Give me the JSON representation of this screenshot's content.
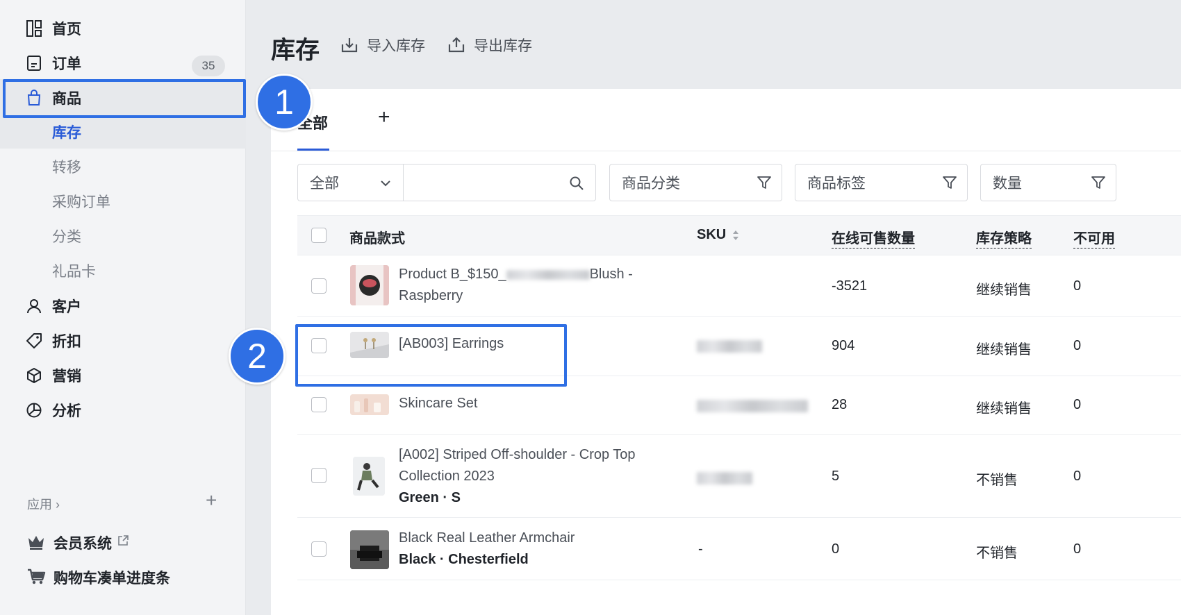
{
  "sidebar": {
    "items": [
      {
        "label": "首页",
        "icon": "home-grid-icon"
      },
      {
        "label": "订单",
        "icon": "order-doc-icon",
        "badge": "35"
      },
      {
        "label": "商品",
        "icon": "shopping-bag-icon"
      },
      {
        "label": "客户",
        "icon": "person-icon"
      },
      {
        "label": "折扣",
        "icon": "tag-icon"
      },
      {
        "label": "营销",
        "icon": "cube-icon"
      },
      {
        "label": "分析",
        "icon": "pie-chart-icon"
      }
    ],
    "sub_items": [
      "库存",
      "转移",
      "采购订单",
      "分类",
      "礼品卡"
    ],
    "apps_label": "应用 ›",
    "apps_add": "+",
    "apps": [
      {
        "label": "会员系统",
        "icon": "crown-icon"
      },
      {
        "label": "购物车凑单进度条",
        "icon": "cart-icon"
      }
    ]
  },
  "markers": [
    "1",
    "2"
  ],
  "header": {
    "title": "库存",
    "import_label": "导入库存",
    "export_label": "导出库存"
  },
  "tabs": {
    "active": "全部",
    "add": "+"
  },
  "filters": {
    "scope_select": "全部",
    "search_placeholder": "",
    "category": "商品分类",
    "tags": "商品标签",
    "quantity": "数量"
  },
  "table": {
    "columns": [
      "商品款式",
      "SKU",
      "在线可售数量",
      "库存策略",
      "不可用"
    ],
    "rows": [
      {
        "name": "Product B_$150_",
        "name_tail": "Blush -",
        "name2": "Raspberry",
        "variant": "",
        "sku": "",
        "qty": "-3521",
        "policy": "继续销售",
        "unavailable": "0"
      },
      {
        "name": "[AB003] Earrings",
        "name2": "",
        "variant": "",
        "sku": "",
        "qty": "904",
        "policy": "继续销售",
        "unavailable": "0"
      },
      {
        "name": "Skincare Set",
        "name2": "",
        "variant": "",
        "sku": "",
        "qty": "28",
        "policy": "继续销售",
        "unavailable": "0"
      },
      {
        "name": "[A002] Striped Off-shoulder - Crop Top",
        "name2": "Collection 2023",
        "variant": "Green · S",
        "sku": "",
        "qty": "5",
        "policy": "不销售",
        "unavailable": "0"
      },
      {
        "name": "Black Real Leather Armchair",
        "name2": "",
        "variant": "Black · Chesterfield",
        "sku": "-",
        "qty": "0",
        "policy": "不销售",
        "unavailable": "0"
      }
    ]
  },
  "colors": {
    "accent": "#2f6fe4",
    "active_text": "#2a5bd7"
  }
}
